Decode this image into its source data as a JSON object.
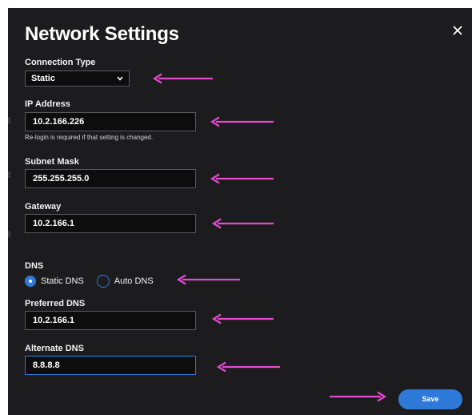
{
  "dialog": {
    "title": "Network Settings",
    "close_icon": "close-icon",
    "save_label": "Save"
  },
  "connection_type": {
    "label": "Connection Type",
    "selected": "Static"
  },
  "ip_address": {
    "label": "IP Address",
    "value": "10.2.166.226",
    "hint": "Re-login is required if that setting is changed."
  },
  "subnet_mask": {
    "label": "Subnet Mask",
    "value": "255.255.255.0"
  },
  "gateway": {
    "label": "Gateway",
    "value": "10.2.166.1"
  },
  "dns": {
    "label": "DNS",
    "options": [
      {
        "label": "Static DNS",
        "checked": true
      },
      {
        "label": "Auto DNS",
        "checked": false
      }
    ]
  },
  "preferred_dns": {
    "label": "Preferred DNS",
    "value": "10.2.166.1"
  },
  "alternate_dns": {
    "label": "Alternate DNS",
    "value": "8.8.8.8"
  },
  "colors": {
    "background": "#1c1c1e",
    "accent": "#2f7ad9",
    "annotation_arrow": "#e34ad1"
  }
}
